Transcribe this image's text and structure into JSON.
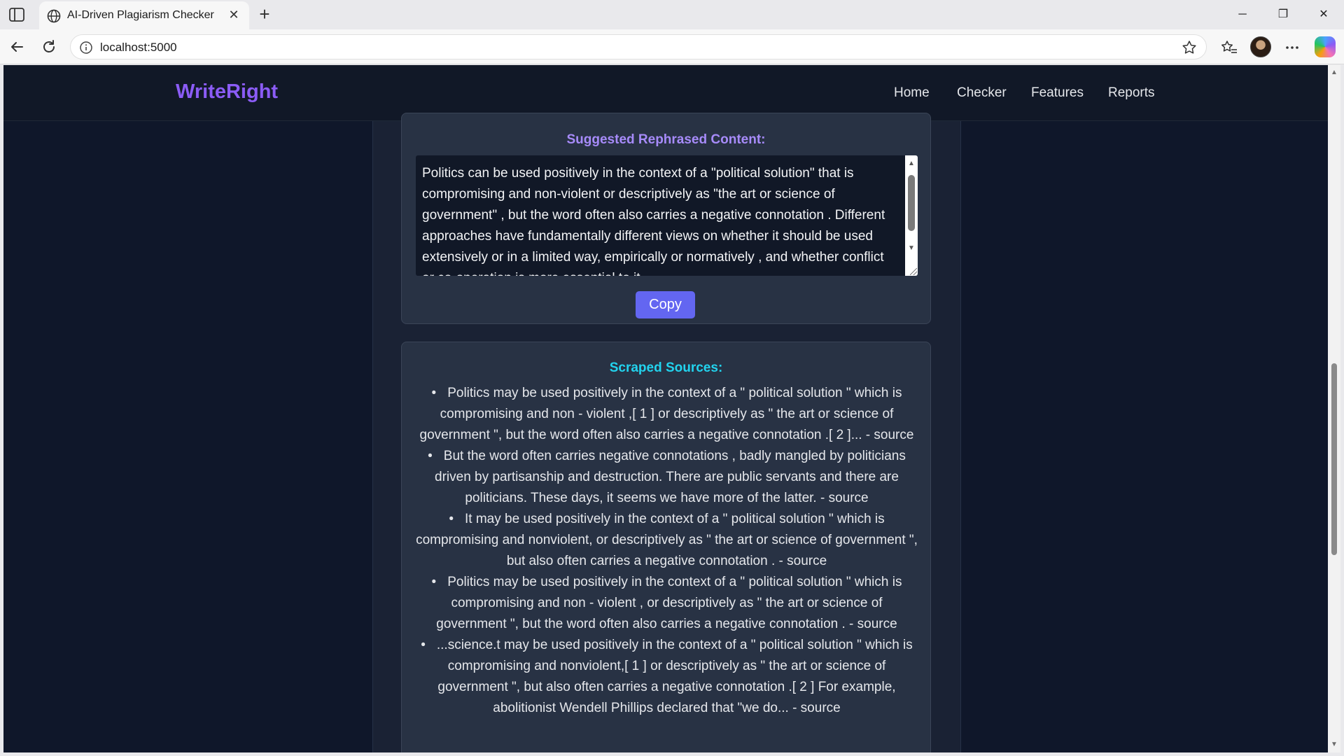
{
  "browser": {
    "tab_title": "AI-Driven Plagiarism Checker",
    "url": "localhost:5000"
  },
  "site": {
    "logo": "WriteRight",
    "nav": [
      {
        "label": "Home"
      },
      {
        "label": "Checker"
      },
      {
        "label": "Features"
      },
      {
        "label": "Reports"
      }
    ]
  },
  "rephrase": {
    "title": "Suggested Rephrased Content:",
    "text": "Politics can be used positively in the context of a \"political solution\" that is compromising and non-violent or descriptively as \"the art or science of government\" , but the word often also carries a negative connotation . Different approaches have fundamentally different views on whether it should be used extensively or in a limited way, empirically or normatively , and whether conflict or co-operation is more essential to it.",
    "copy_label": "Copy"
  },
  "sources": {
    "title": "Scraped Sources:",
    "items": [
      {
        "text": "Politics may be used positively in the context of a \" political solution \" which is compromising and non - violent ,[ 1 ] or descriptively as \" the art or science of government \", but the word often also carries a negative connotation .[ 2 ]... - source"
      },
      {
        "text": "But the word often carries negative connotations , badly mangled by politicians driven by partisanship and destruction. There are public servants and there are politicians. These days, it seems we have more of the latter. - source"
      },
      {
        "text": "It may be used positively in the context of a \" political solution \" which is compromising and nonviolent, or descriptively as \" the art or science of government \", but also often carries a negative connotation . - source"
      },
      {
        "text": "Politics may be used positively in the context of a \" political solution \" which is compromising and non - violent , or descriptively as \" the art or science of government \", but the word often also carries a negative connotation . - source"
      },
      {
        "text": "...science.t may be used positively in the context of a \" political solution \" which is compromising and nonviolent,[ 1 ] or descriptively as \" the art or science of government \", but also often carries a negative connotation .[ 2 ] For example, abolitionist Wendell Phillips declared that \"we do... - source"
      }
    ]
  },
  "colors": {
    "logo": "#8b5cf6",
    "rephrase_title": "#a78bfa",
    "sources_title": "#22d3ee",
    "copy_button": "#6366f1",
    "page_bg": "#0f172a"
  },
  "icons": [
    "sidebar-toggle-icon",
    "globe-icon",
    "close-icon",
    "plus-icon",
    "minimize-icon",
    "restore-icon",
    "close-window-icon",
    "back-icon",
    "reload-icon",
    "info-icon",
    "star-icon",
    "favorites-icon",
    "more-icon",
    "copilot-icon"
  ]
}
